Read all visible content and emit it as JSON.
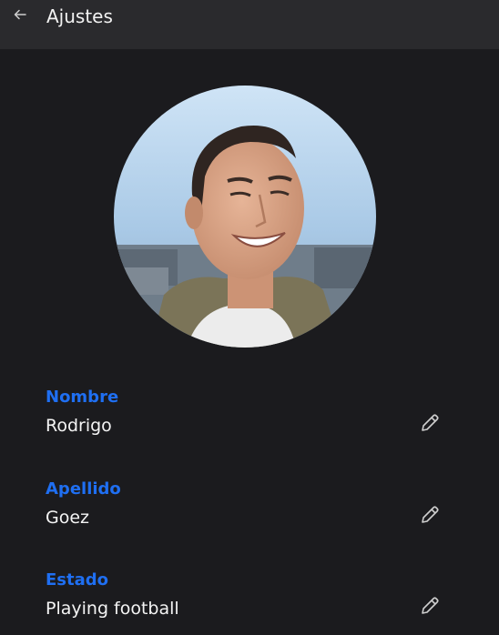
{
  "header": {
    "back_icon": "arrow-left-icon",
    "title": "Ajustes"
  },
  "profile": {
    "avatar_alt": "profile-photo"
  },
  "fields": [
    {
      "label": "Nombre",
      "value": "Rodrigo",
      "edit_icon": "pencil-icon"
    },
    {
      "label": "Apellido",
      "value": "Goez",
      "edit_icon": "pencil-icon"
    },
    {
      "label": "Estado",
      "value": "Playing football",
      "edit_icon": "pencil-icon"
    }
  ],
  "colors": {
    "background": "#1b1b1e",
    "header": "#2a2a2d",
    "accent": "#1f6ff2",
    "text": "#f4f4f4",
    "icon": "#cfcfcf"
  }
}
